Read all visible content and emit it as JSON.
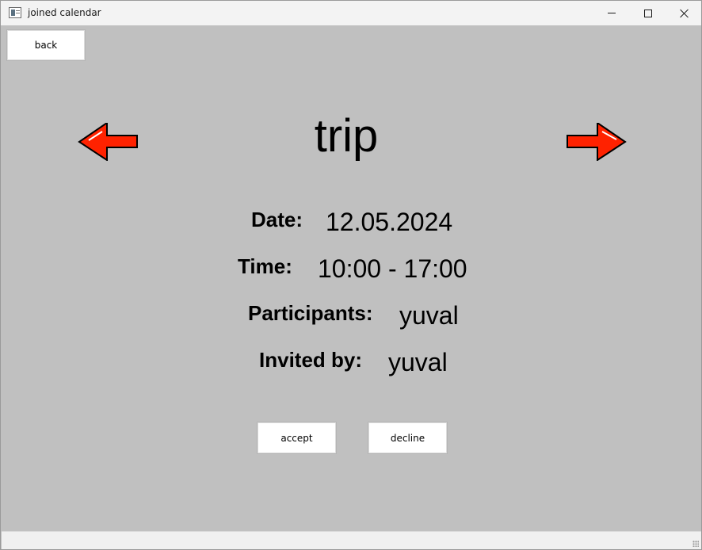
{
  "window": {
    "title": "joined calendar"
  },
  "nav": {
    "back_label": "back"
  },
  "event": {
    "name": "trip",
    "date_label": "Date:",
    "date_value": "12.05.2024",
    "time_label": "Time:",
    "time_value": "10:00 - 17:00",
    "participants_label": "Participants:",
    "participants_value": "yuval",
    "invited_label": "Invited by:",
    "invited_value": "yuval"
  },
  "actions": {
    "accept_label": "accept",
    "decline_label": "decline"
  },
  "colors": {
    "background": "#c0c0c0",
    "arrow_fill": "#ff2200",
    "arrow_stroke": "#000000"
  },
  "icons": [
    "app-icon",
    "minimize-icon",
    "maximize-icon",
    "close-icon",
    "arrow-left-icon",
    "arrow-right-icon"
  ]
}
